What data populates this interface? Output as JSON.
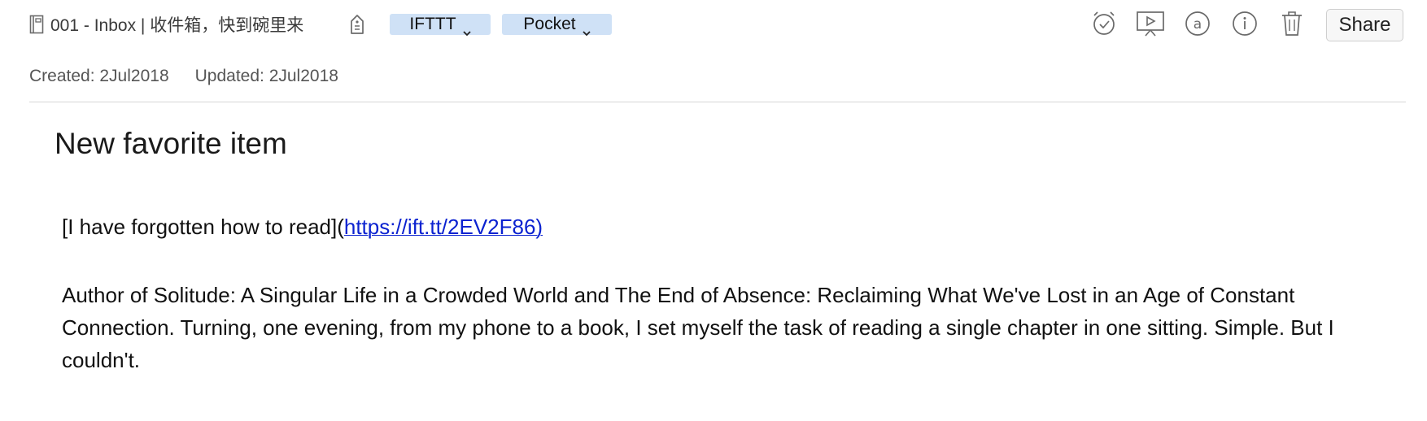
{
  "header": {
    "notebook_label": "001 - Inbox | 收件箱，快到碗里来",
    "tags": [
      {
        "label": "IFTTT"
      },
      {
        "label": "Pocket"
      }
    ],
    "share_label": "Share"
  },
  "meta": {
    "created": "Created: 2Jul2018",
    "updated": "Updated: 2Jul2018"
  },
  "note": {
    "title": "New favorite item",
    "link_prefix": "[I have forgotten how to read](",
    "link_text": "https://ift.tt/2EV2F86)",
    "paragraph": "Author of Solitude: A Singular Life in a Crowded World and The End of Absence: Reclaiming What We've Lost in an Age of Constant Connection. Turning, one evening, from my phone to a book, I set myself the task of reading a single chapter in one sitting. Simple. But I couldn't."
  },
  "colors": {
    "tag_chip_bg": "#cfe1f6",
    "link": "#0b22d0",
    "icon_stroke": "#6a6a6a"
  },
  "icons": [
    "notebook-icon",
    "tag-icon",
    "chevron-down-icon",
    "reminder-icon",
    "presentation-icon",
    "at-mention-icon",
    "info-icon",
    "trash-icon"
  ]
}
